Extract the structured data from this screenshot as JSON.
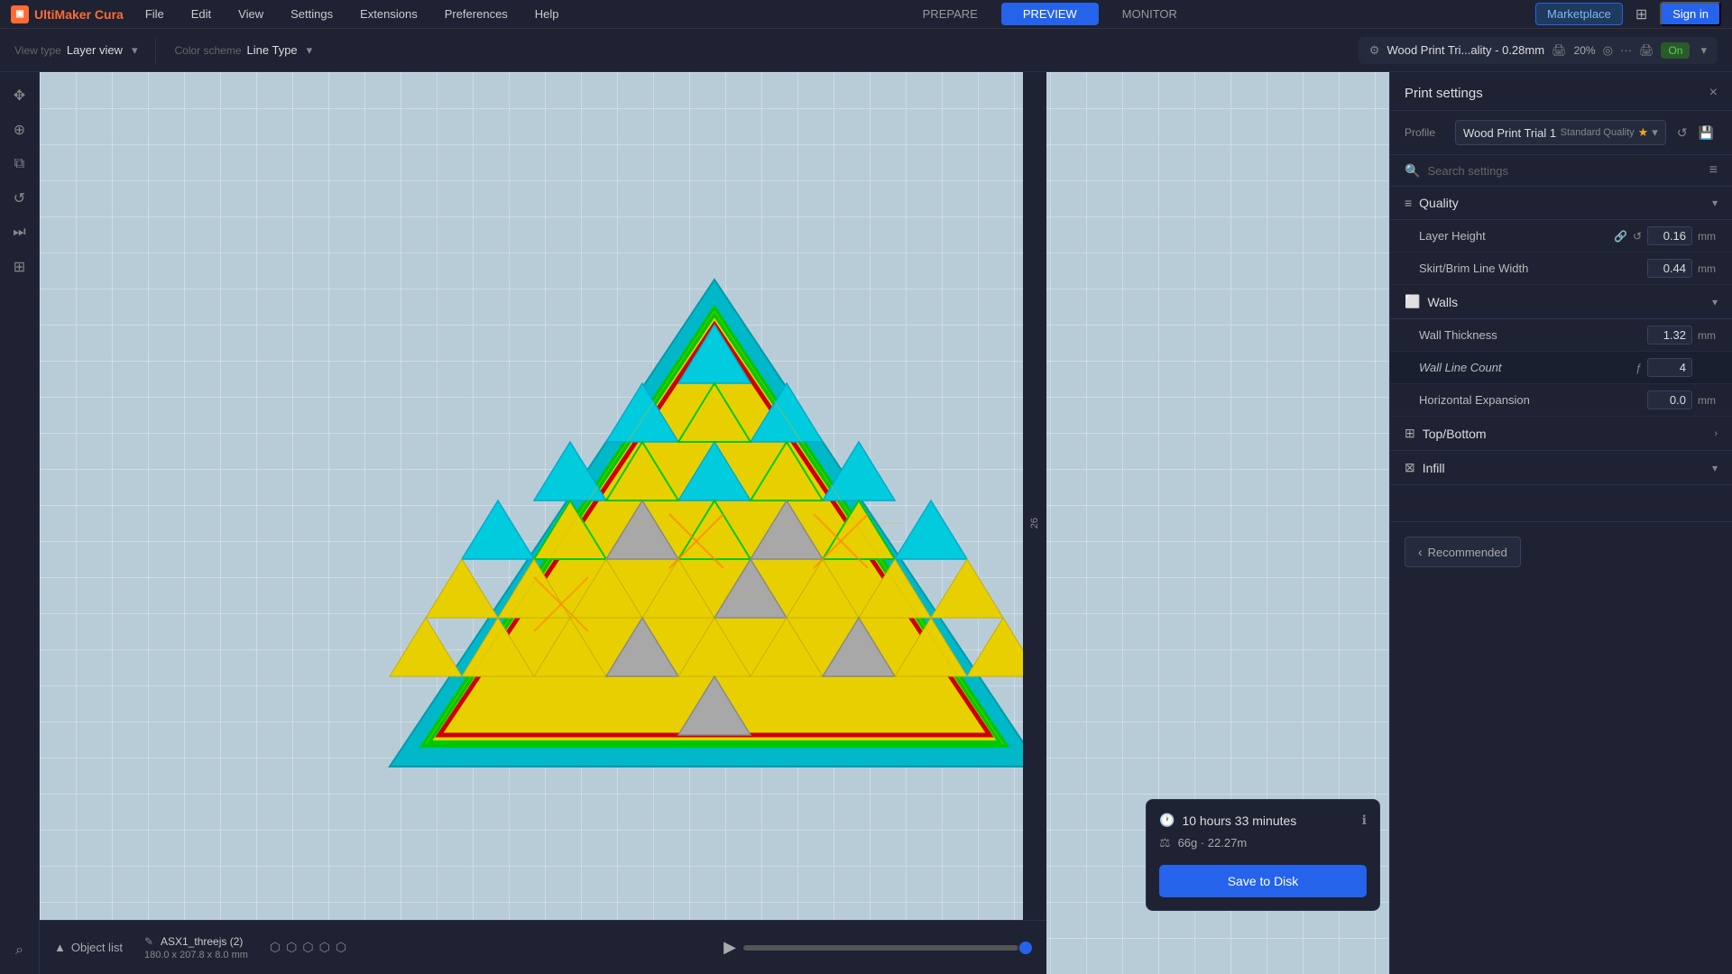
{
  "app": {
    "name": "UltiMaker Cura",
    "version": ""
  },
  "menu": {
    "items": [
      "File",
      "Edit",
      "View",
      "Settings",
      "Extensions",
      "Preferences",
      "Help"
    ]
  },
  "tabs": {
    "prepare": "PREPARE",
    "preview": "PREVIEW",
    "monitor": "MONITOR",
    "active": "PREVIEW"
  },
  "top_right": {
    "marketplace": "Marketplace",
    "signin": "Sign in"
  },
  "sub_toolbar": {
    "view_type_label": "View type",
    "view_type_value": "Layer view",
    "color_scheme_label": "Color scheme",
    "color_scheme_value": "Line Type",
    "printer": "Wood Print Tri...ality - 0.28mm",
    "percent": "20%",
    "on_label": "On"
  },
  "panel": {
    "title": "Print settings",
    "close": "×",
    "profile_label": "Profile",
    "profile_name": "Wood Print Trial 1",
    "profile_sub": "Standard Quality",
    "search_placeholder": "Search settings",
    "sections": [
      {
        "id": "quality",
        "icon": "≡",
        "title": "Quality",
        "expanded": true,
        "settings": [
          {
            "name": "Layer Height",
            "value": "0.16",
            "unit": "mm",
            "has_link": true,
            "has_reset": true
          },
          {
            "name": "Skirt/Brim Line Width",
            "value": "0.44",
            "unit": "mm"
          }
        ]
      },
      {
        "id": "walls",
        "icon": "⬜",
        "title": "Walls",
        "expanded": true,
        "settings": [
          {
            "name": "Wall Thickness",
            "value": "1.32",
            "unit": "mm"
          },
          {
            "name": "Wall Line Count",
            "value": "4",
            "unit": "",
            "is_formula": true,
            "is_sub": true
          },
          {
            "name": "Horizontal Expansion",
            "value": "0.0",
            "unit": "mm"
          }
        ]
      },
      {
        "id": "top_bottom",
        "icon": "⊞",
        "title": "Top/Bottom",
        "expanded": false
      },
      {
        "id": "infill",
        "icon": "⊠",
        "title": "Infill",
        "expanded": false
      }
    ],
    "recommended_label": "Recommended"
  },
  "bottom": {
    "object_list": "Object list",
    "object_name": "ASX1_threejs (2)",
    "object_dims": "180.0 x 207.8 x 8.0 mm"
  },
  "estimate": {
    "time": "10 hours 33 minutes",
    "weight": "66g · 22.27m",
    "save_label": "Save to Disk"
  },
  "layer_bar": {
    "number": "26"
  }
}
